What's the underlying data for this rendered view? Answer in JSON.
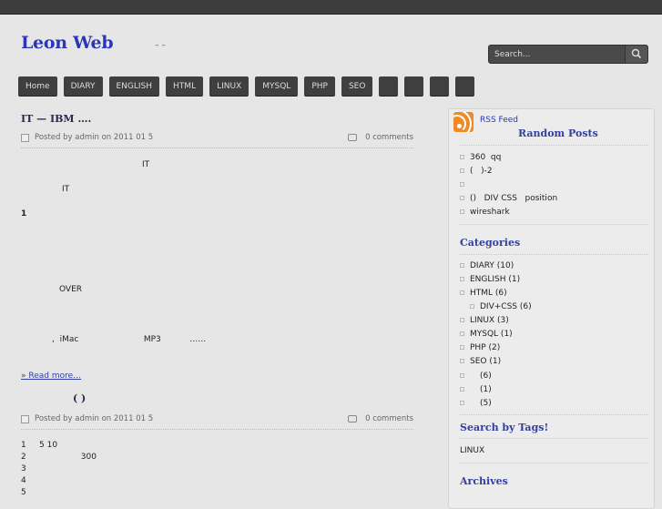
{
  "site": {
    "title": "Leon  Web",
    "description": "–       –"
  },
  "search": {
    "placeholder": "Search..."
  },
  "nav": [
    "Home",
    "DIARY",
    "ENGLISH",
    "HTML",
    "LINUX",
    "MYSQL",
    "PHP",
    "SEO",
    "",
    "",
    "",
    ""
  ],
  "posts": [
    {
      "title": "IT          —     IBM          ….",
      "meta_left": "Posted by admin on 2011 01 5",
      "meta_right": "0 comments",
      "lines": [
        "IT",
        "IT",
        "1",
        "OVER",
        ",  iMac                         MP3           ……"
      ],
      "read_more": "» Read more…"
    },
    {
      "title": "(   )",
      "meta_left": "Posted by admin on 2011 01 5",
      "meta_right": "0 comments",
      "lines": [
        "1     5 10",
        "2                     300",
        "3",
        "4",
        "5"
      ]
    }
  ],
  "sidebar": {
    "rss": "RSS Feed",
    "random_posts": {
      "title": "Random Posts",
      "items": [
        "360  qq",
        "(   )-2",
        "",
        "()   DIV CSS   position",
        "wireshark"
      ]
    },
    "categories": {
      "title": "Categories",
      "items": [
        "DIARY (10)",
        "ENGLISH (1)",
        "HTML (6)",
        "DIV+CSS (6)",
        "LINUX (3)",
        "MYSQL (1)",
        "PHP (2)",
        "SEO (1)",
        "(6)",
        "(1)",
        "(5)"
      ]
    },
    "tags": {
      "title": "Search by Tags!",
      "items": [
        "LINUX"
      ]
    },
    "archives": {
      "title": "Archives"
    }
  }
}
